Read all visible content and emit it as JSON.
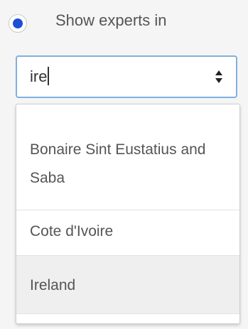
{
  "filter": {
    "radio_label": "Show experts in",
    "radio_selected": true
  },
  "country_select": {
    "typed_value": "ire",
    "icon": "sort-icon"
  },
  "dropdown": {
    "options": [
      {
        "label": "Bonaire Sint Eustatius and Saba",
        "highlighted": false
      },
      {
        "label": "Cote d'Ivoire",
        "highlighted": false
      },
      {
        "label": "Ireland",
        "highlighted": true
      }
    ]
  },
  "colors": {
    "radio_selected": "#1d4fd6",
    "focus_border": "#7fb0e0",
    "highlight_bg": "#efefef"
  }
}
